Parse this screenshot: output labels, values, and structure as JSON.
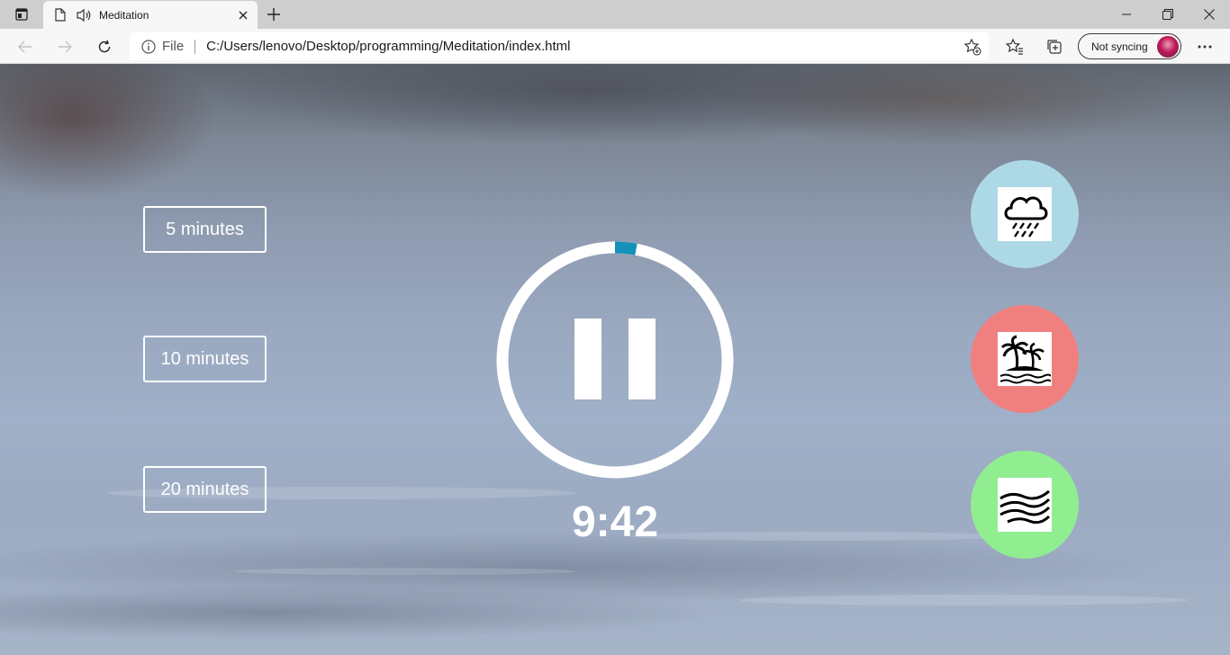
{
  "browser": {
    "tab_title": "Meditation",
    "address_scheme": "File",
    "address_url": "C:/Users/lenovo/Desktop/programming/Meditation/index.html",
    "profile_label": "Not syncing"
  },
  "app": {
    "durations": [
      "5 minutes",
      "10 minutes",
      "20 minutes"
    ],
    "time_display": "9:42",
    "progress_fraction": 0.03,
    "progress_color": "#1391b8",
    "sounds": [
      {
        "name": "rain",
        "icon": "rain-cloud-icon",
        "color": "#add8e6"
      },
      {
        "name": "beach",
        "icon": "palm-island-icon",
        "color": "#f08080"
      },
      {
        "name": "wind",
        "icon": "wind-icon",
        "color": "#90ee90"
      }
    ]
  }
}
